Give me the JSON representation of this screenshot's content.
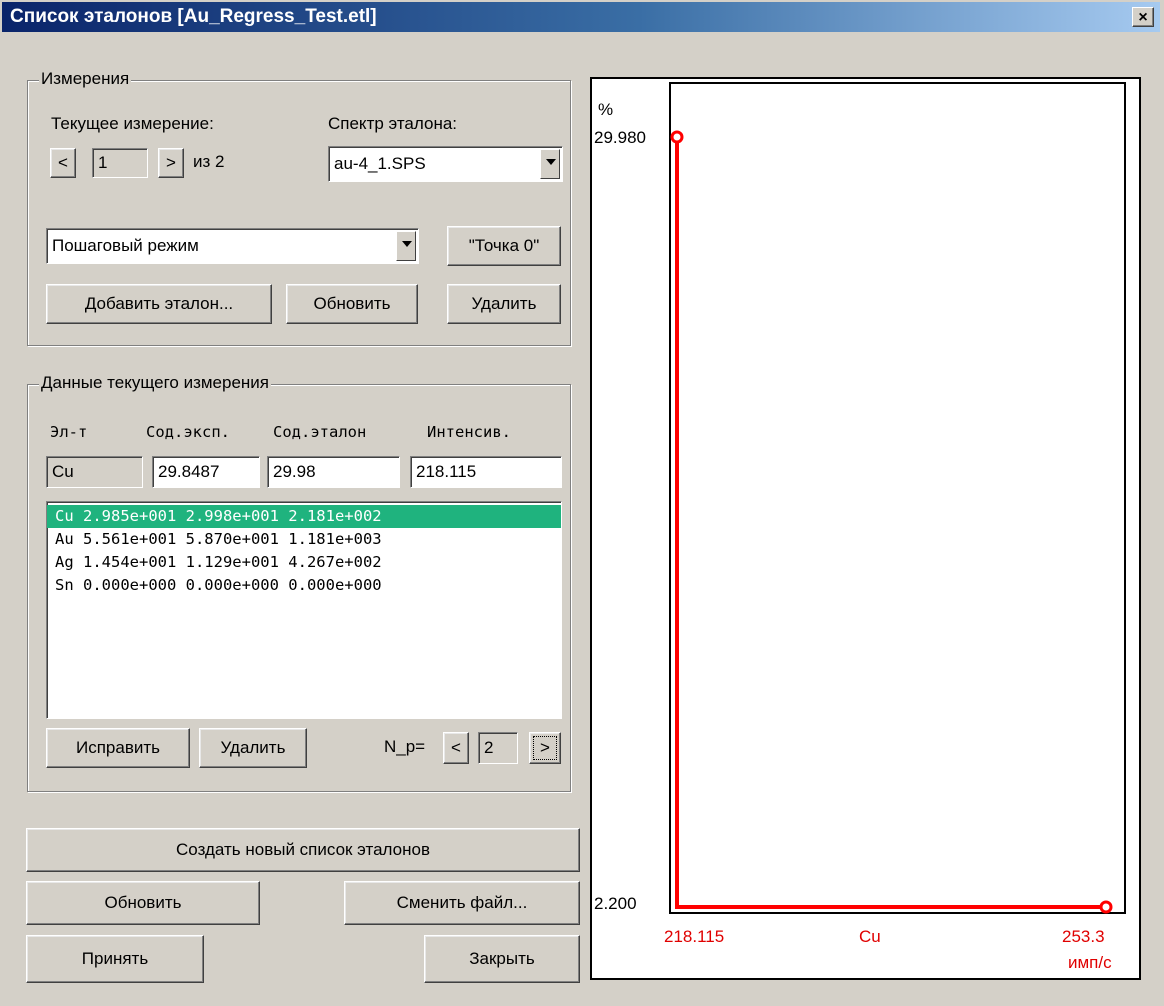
{
  "window": {
    "title": "Список эталонов [Au_Regress_Test.etl]",
    "close_label": "×"
  },
  "measurements": {
    "legend": "Измерения",
    "current_label": "Текущее измерение:",
    "prev_label": "<",
    "next_label": ">",
    "current_value": "1",
    "of_label": "из  2",
    "spectrum_label": "Спектр эталона:",
    "spectrum_value": "au-4_1.SPS",
    "mode_value": "Пошаговый режим",
    "point0_label": "\"Точка 0\"",
    "add_label": "Добавить эталон...",
    "refresh_label": "Обновить",
    "delete_label": "Удалить"
  },
  "current_data": {
    "legend": "Данные текущего измерения",
    "headers": [
      "Эл-т",
      "Сод.эксп.",
      "Сод.эталон",
      "Интенсив."
    ],
    "element": "Cu",
    "exp": "29.8487",
    "std": "29.98",
    "intensity": "218.115",
    "rows": [
      "Cu 2.985e+001 2.998e+001 2.181e+002",
      "Au 5.561e+001 5.870e+001 1.181e+003",
      "Ag 1.454e+001 1.129e+001 4.267e+002",
      "Sn 0.000e+000 0.000e+000 0.000e+000"
    ],
    "selected_index": 0,
    "fix_label": "Исправить",
    "delete_label": "Удалить",
    "np_label": "N_p=",
    "np_prev": "<",
    "np_value": "2",
    "np_next": ">"
  },
  "actions": {
    "create_label": "Создать новый список эталонов",
    "refresh_label": "Обновить",
    "change_file_label": "Сменить файл...",
    "accept_label": "Принять",
    "close_label": "Закрыть"
  },
  "chart_data": {
    "type": "line",
    "ylabel": "%",
    "xlabel": "имп/с",
    "series_label": "Cu",
    "y_top_label": "29.980",
    "y_bottom_label": "2.200",
    "x_left_label": "218.115",
    "x_right_label": "253.3",
    "xlim": [
      218.115,
      253.3
    ],
    "ylim": [
      2.2,
      29.98
    ],
    "points": [
      {
        "x": 218.115,
        "y": 29.98
      },
      {
        "x": 218.115,
        "y": 2.2
      },
      {
        "x": 253.3,
        "y": 2.2
      }
    ],
    "markers": [
      {
        "x": 218.115,
        "y": 29.98
      },
      {
        "x": 253.3,
        "y": 2.2
      }
    ],
    "line_color": "#ff0000"
  }
}
